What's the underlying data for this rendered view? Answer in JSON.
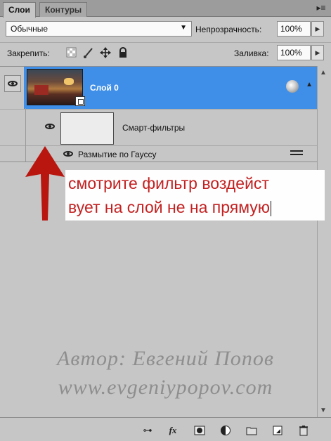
{
  "tabs": [
    {
      "label": "Слои"
    },
    {
      "label": "Контуры"
    }
  ],
  "menu_icon": "panel-menu-icon",
  "blend_mode": {
    "value": "Обычные"
  },
  "opacity": {
    "label": "Непрозрачность:",
    "value": "100%"
  },
  "lock": {
    "label": "Закрепить:",
    "icons": [
      "lock-transparent-icon",
      "lock-brush-icon",
      "lock-move-icon",
      "lock-all-icon"
    ]
  },
  "fill": {
    "label": "Заливка:",
    "value": "100%"
  },
  "layers": [
    {
      "name": "Слой 0",
      "selected": true,
      "visible": true,
      "type": "smart-object"
    }
  ],
  "smart_filters": {
    "label": "Смарт-фильтры"
  },
  "filter": {
    "label": "Размытие по Гауссу"
  },
  "annotation": {
    "line1": "смотрите фильтр воздейст",
    "line2": "вует на слой не на прямую",
    "color": "#c32121"
  },
  "watermark": {
    "line1": "Автор: Евгений Попов",
    "line2": "www.evgeniypopov.com"
  },
  "colors": {
    "selection": "#3f8fe8",
    "panel_bg": "#c6c6c6"
  },
  "bottom_icons": [
    "link-icon",
    "fx-icon",
    "mask-icon",
    "adjustment-icon",
    "group-folder-icon",
    "new-layer-icon",
    "trash-icon"
  ]
}
